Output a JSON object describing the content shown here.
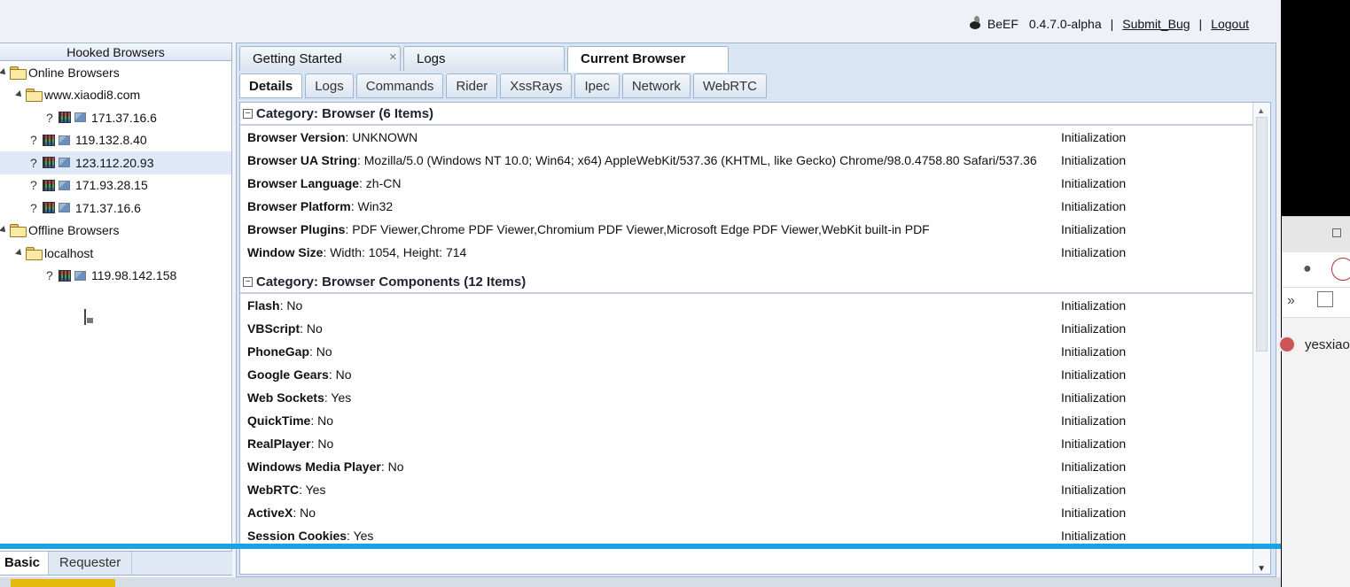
{
  "topbar": {
    "app_name": "BeEF",
    "version": "0.4.7.0-alpha",
    "separator": "|",
    "submit_bug": "Submit_Bug",
    "logout": "Logout"
  },
  "hooked": {
    "title": "Hooked Browsers",
    "online_label": "Online Browsers",
    "offline_label": "Offline Browsers",
    "online_domain": "www.xiaodi8.com",
    "online_domain_ip": "171.37.16.6",
    "online_ips": [
      "119.132.8.40",
      "123.112.20.93",
      "171.93.28.15",
      "171.37.16.6"
    ],
    "offline_domain": "localhost",
    "offline_ip": "119.98.142.158",
    "unknown_mark": "?"
  },
  "left_tabs": {
    "basic": "Basic",
    "requester": "Requester"
  },
  "main_tabs": [
    "Getting Started",
    "Logs",
    "Current Browser"
  ],
  "sub_tabs": [
    "Details",
    "Logs",
    "Commands",
    "Rider",
    "XssRays",
    "Ipec",
    "Network",
    "WebRTC"
  ],
  "categories": [
    {
      "title": "Category: Browser (6 Items)",
      "items": [
        {
          "name": "Browser Version",
          "value": ": UNKNOWN",
          "source": "Initialization"
        },
        {
          "name": "Browser UA String",
          "value": ": Mozilla/5.0 (Windows NT 10.0; Win64; x64) AppleWebKit/537.36 (KHTML, like Gecko) Chrome/98.0.4758.80 Safari/537.36",
          "source": "Initialization"
        },
        {
          "name": "Browser Language",
          "value": ": zh-CN",
          "source": "Initialization"
        },
        {
          "name": "Browser Platform",
          "value": ": Win32",
          "source": "Initialization"
        },
        {
          "name": "Browser Plugins",
          "value": ": PDF Viewer,Chrome PDF Viewer,Chromium PDF Viewer,Microsoft Edge PDF Viewer,WebKit built-in PDF",
          "source": "Initialization"
        },
        {
          "name": "Window Size",
          "value": ": Width: 1054, Height: 714",
          "source": "Initialization"
        }
      ]
    },
    {
      "title": "Category: Browser Components (12 Items)",
      "items": [
        {
          "name": "Flash",
          "value": ": No",
          "source": "Initialization"
        },
        {
          "name": "VBScript",
          "value": ": No",
          "source": "Initialization"
        },
        {
          "name": "PhoneGap",
          "value": ": No",
          "source": "Initialization"
        },
        {
          "name": "Google Gears",
          "value": ": No",
          "source": "Initialization"
        },
        {
          "name": "Web Sockets",
          "value": ": Yes",
          "source": "Initialization"
        },
        {
          "name": "QuickTime",
          "value": ": No",
          "source": "Initialization"
        },
        {
          "name": "RealPlayer",
          "value": ": No",
          "source": "Initialization"
        },
        {
          "name": "Windows Media Player",
          "value": ": No",
          "source": "Initialization"
        },
        {
          "name": "WebRTC",
          "value": ": Yes",
          "source": "Initialization"
        },
        {
          "name": "ActiveX",
          "value": ": No",
          "source": "Initialization"
        },
        {
          "name": "Session Cookies",
          "value": ": Yes",
          "source": "Initialization"
        }
      ]
    }
  ],
  "side_window": {
    "user_text": "yesxiao",
    "more_glyph": "»"
  },
  "colors": {
    "accent_line": "#1aa3e0",
    "selected_row": "#dfe8f6"
  }
}
